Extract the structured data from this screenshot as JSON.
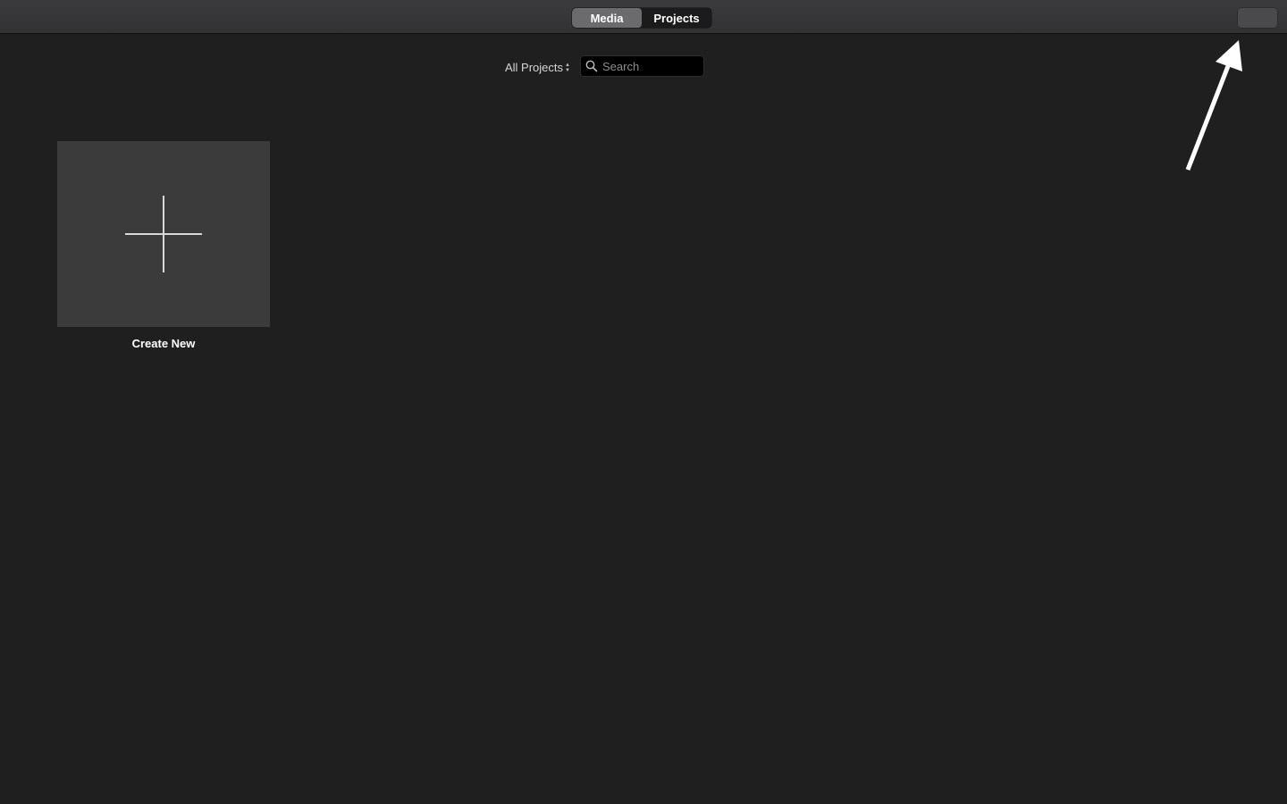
{
  "toolbar": {
    "tabs": [
      {
        "label": "Media",
        "active": true
      },
      {
        "label": "Projects",
        "active": false
      }
    ]
  },
  "filter": {
    "scope_label": "All Projects",
    "search_placeholder": "Search",
    "search_value": ""
  },
  "grid": {
    "create_new_label": "Create New"
  },
  "colors": {
    "background": "#1f1f1f",
    "toolbar": "#363638",
    "tile": "#3b3b3b",
    "active_segment": "#6b6b6d",
    "annotation_arrow": "#ffffff"
  },
  "icons": {
    "search": "search-icon",
    "plus": "plus-icon",
    "annotation": "annotation-arrow-icon"
  }
}
